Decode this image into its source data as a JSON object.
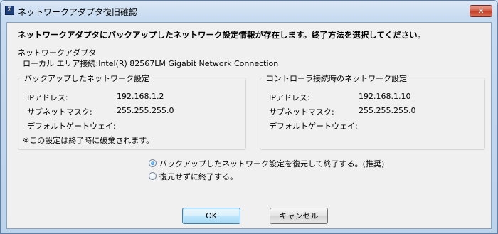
{
  "window": {
    "title": "ネットワークアダプタ復旧確認",
    "app_icon_glyph": "Σ",
    "close_glyph": "✕"
  },
  "message": "ネットワークアダプタにバックアップしたネットワーク設定情報が存在します。終了方法を選択してください。",
  "adapter": {
    "label": "ネットワークアダプタ",
    "name": "ローカル エリア接続:Intel(R) 82567LM Gigabit Network Connection"
  },
  "backup_group": {
    "title": "バックアップしたネットワーク設定",
    "rows": [
      {
        "label": "IPアドレス:",
        "value": "192.168.1.2"
      },
      {
        "label": "サブネットマスク:",
        "value": "255.255.255.0"
      },
      {
        "label": "デフォルトゲートウェイ:",
        "value": ""
      }
    ],
    "note": "※この設定は終了時に破棄されます。"
  },
  "controller_group": {
    "title": "コントローラ接続時のネットワーク設定",
    "rows": [
      {
        "label": "IPアドレス:",
        "value": "192.168.1.10"
      },
      {
        "label": "サブネットマスク:",
        "value": "255.255.255.0"
      },
      {
        "label": "デフォルトゲートウェイ:",
        "value": ""
      }
    ]
  },
  "options": [
    {
      "label": "バックアップしたネットワーク設定を復元して終了する。(推奨)",
      "selected": true
    },
    {
      "label": "復元せずに終了する。",
      "selected": false
    }
  ],
  "buttons": {
    "ok": "OK",
    "cancel": "キャンセル"
  }
}
